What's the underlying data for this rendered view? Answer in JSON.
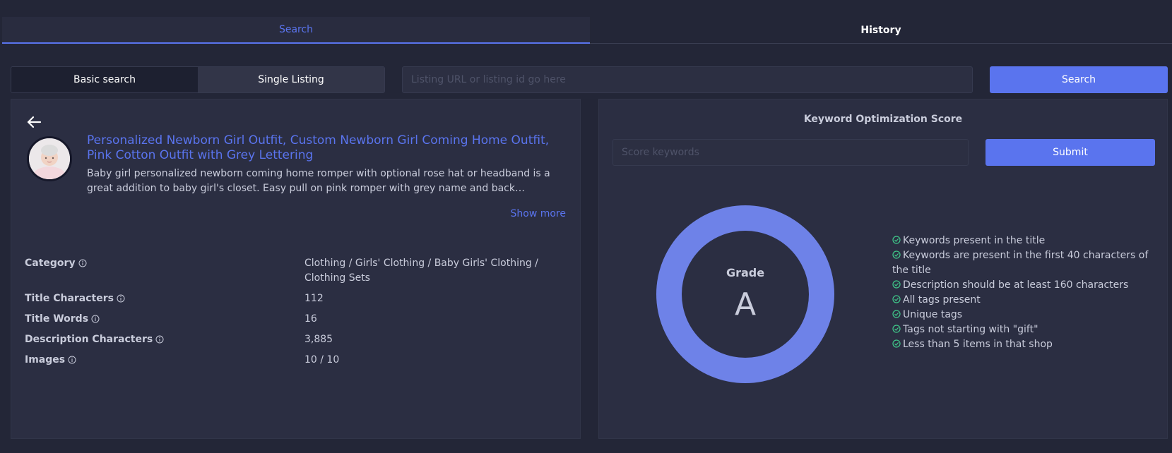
{
  "tabs": [
    {
      "label": "Search",
      "active": true
    },
    {
      "label": "History",
      "active": false
    }
  ],
  "modes": {
    "basic": "Basic search",
    "single": "Single Listing"
  },
  "url_input": {
    "value": "",
    "placeholder": "Listing URL or listing id go here"
  },
  "search_button": "Search",
  "listing": {
    "title": "Personalized Newborn Girl Outfit, Custom Newborn Girl Coming Home Outfit, Pink Cotton Outfit with Grey Lettering",
    "description": "Baby girl personalized newborn coming home romper with optional rose hat or headband is a great addition to baby girl's closet. Easy pull on pink romper with grey name and back…",
    "show_more": "Show more",
    "details": [
      {
        "label": "Category",
        "value": "Clothing / Girls' Clothing / Baby Girls' Clothing / Clothing Sets"
      },
      {
        "label": "Title Characters",
        "value": "112"
      },
      {
        "label": "Title Words",
        "value": "16"
      },
      {
        "label": "Description Characters",
        "value": "3,885"
      },
      {
        "label": "Images",
        "value": "10 / 10"
      }
    ]
  },
  "score": {
    "title": "Keyword Optimization Score",
    "input_placeholder": "Score keywords",
    "input_value": "",
    "submit": "Submit",
    "grade_label": "Grade",
    "grade": "A",
    "checks": [
      "Keywords present in the title",
      "Keywords are present in the first 40 characters of the title",
      "Description should be at least 160 characters",
      "All tags present",
      "Unique tags",
      "Tags not starting with \"gift\"",
      "Less than 5 items in that shop"
    ]
  },
  "colors": {
    "accent": "#5a74ee",
    "donut": "#6e82e8",
    "check": "#3fc98a",
    "background": "#232637",
    "panel": "#2b2e42"
  }
}
